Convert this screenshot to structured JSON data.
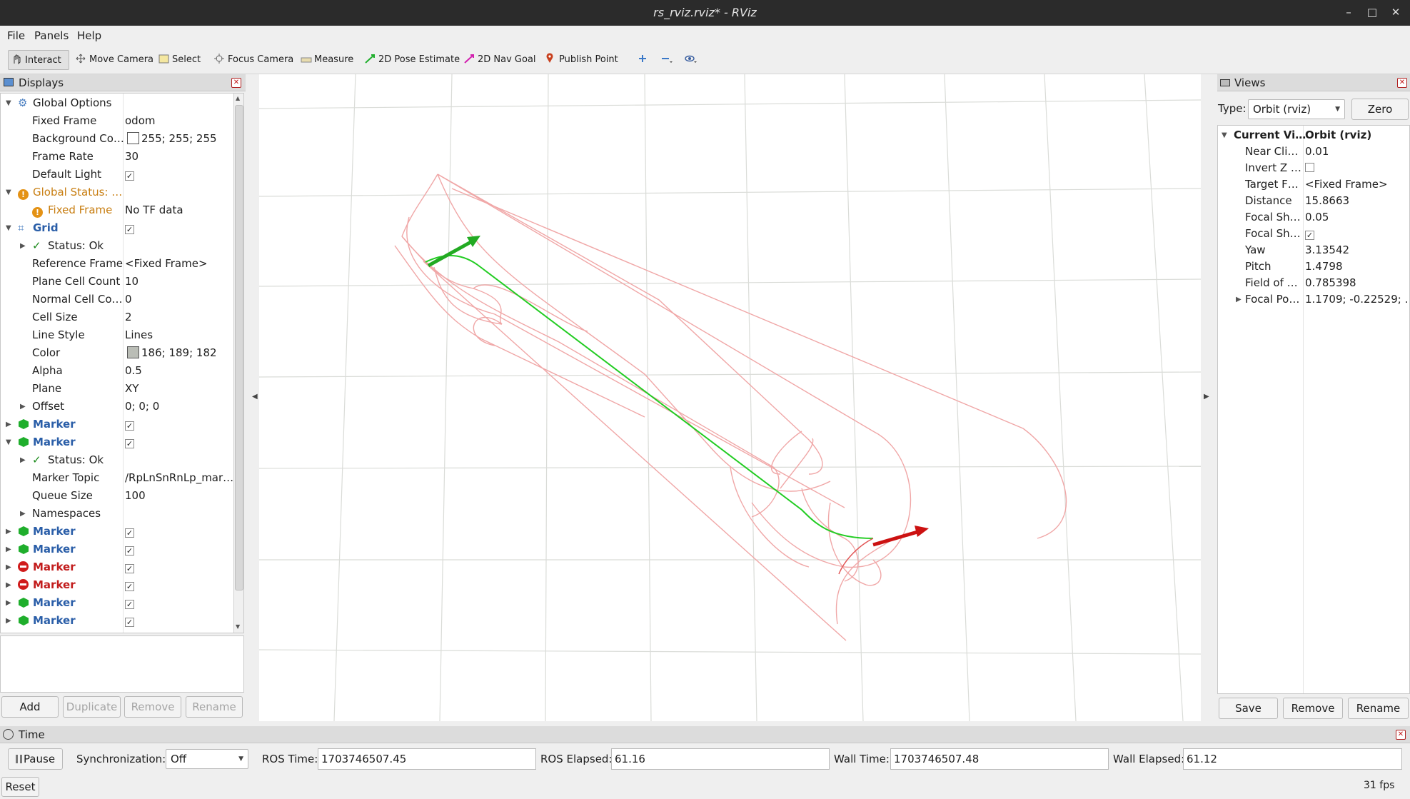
{
  "window": {
    "title": "rs_rviz.rviz* - RViz",
    "minimize": "–",
    "maximize": "□",
    "close": "✕"
  },
  "menu": [
    "File",
    "Panels",
    "Help"
  ],
  "toolbar": {
    "interact": "Interact",
    "move_camera": "Move Camera",
    "select": "Select",
    "focus_camera": "Focus Camera",
    "measure": "Measure",
    "pose_estimate": "2D Pose Estimate",
    "nav_goal": "2D Nav Goal",
    "publish_point": "Publish Point"
  },
  "displays": {
    "title": "Displays",
    "rows": [
      {
        "label": "Global Options",
        "value": ""
      },
      {
        "label": "Fixed Frame",
        "value": "odom"
      },
      {
        "label": "Background Co…",
        "value": "255; 255; 255"
      },
      {
        "label": "Frame Rate",
        "value": "30"
      },
      {
        "label": "Default Light",
        "value": ""
      },
      {
        "label": "Global Status: …",
        "value": ""
      },
      {
        "label": "Fixed Frame",
        "value": "No TF data"
      },
      {
        "label": "Grid",
        "value": ""
      },
      {
        "label": "Status: Ok",
        "value": ""
      },
      {
        "label": "Reference Frame",
        "value": "<Fixed Frame>"
      },
      {
        "label": "Plane Cell Count",
        "value": "10"
      },
      {
        "label": "Normal Cell Co…",
        "value": "0"
      },
      {
        "label": "Cell Size",
        "value": "2"
      },
      {
        "label": "Line Style",
        "value": "Lines"
      },
      {
        "label": "Color",
        "value": "186; 189; 182"
      },
      {
        "label": "Alpha",
        "value": "0.5"
      },
      {
        "label": "Plane",
        "value": "XY"
      },
      {
        "label": "Offset",
        "value": "0; 0; 0"
      },
      {
        "label": "Marker",
        "value": ""
      },
      {
        "label": "Marker",
        "value": ""
      },
      {
        "label": "Status: Ok",
        "value": ""
      },
      {
        "label": "Marker Topic",
        "value": "/RpLnSnRnLp_mar…"
      },
      {
        "label": "Queue Size",
        "value": "100"
      },
      {
        "label": "Namespaces",
        "value": ""
      },
      {
        "label": "Marker",
        "value": ""
      },
      {
        "label": "Marker",
        "value": ""
      },
      {
        "label": "Marker",
        "value": ""
      },
      {
        "label": "Marker",
        "value": ""
      },
      {
        "label": "Marker",
        "value": ""
      },
      {
        "label": "Marker",
        "value": ""
      }
    ],
    "buttons": {
      "add": "Add",
      "duplicate": "Duplicate",
      "remove": "Remove",
      "rename": "Rename"
    }
  },
  "views": {
    "title": "Views",
    "type_label": "Type:",
    "type_value": "Orbit (rviz)",
    "zero": "Zero",
    "rows": [
      {
        "label": "Current Vi…",
        "value": "Orbit (rviz)"
      },
      {
        "label": "Near Cli…",
        "value": "0.01"
      },
      {
        "label": "Invert Z …",
        "value": ""
      },
      {
        "label": "Target F…",
        "value": "<Fixed Frame>"
      },
      {
        "label": "Distance",
        "value": "15.8663"
      },
      {
        "label": "Focal Sh…",
        "value": "0.05"
      },
      {
        "label": "Focal Sh…",
        "value": ""
      },
      {
        "label": "Yaw",
        "value": "3.13542"
      },
      {
        "label": "Pitch",
        "value": "1.4798"
      },
      {
        "label": "Field of …",
        "value": "0.785398"
      },
      {
        "label": "Focal Po…",
        "value": "1.1709; -0.22529; …"
      }
    ],
    "buttons": {
      "save": "Save",
      "remove": "Remove",
      "rename": "Rename"
    }
  },
  "time": {
    "title": "Time",
    "pause": "Pause",
    "sync_label": "Synchronization:",
    "sync_value": "Off",
    "ros_time_label": "ROS Time:",
    "ros_time": "1703746507.45",
    "ros_elapsed_label": "ROS Elapsed:",
    "ros_elapsed": "61.16",
    "wall_time_label": "Wall Time:",
    "wall_time": "1703746507.48",
    "wall_elapsed_label": "Wall Elapsed:",
    "wall_elapsed": "61.12",
    "reset": "Reset",
    "fps": "31 fps"
  },
  "colors": {
    "path_green": "#22cc22",
    "candidate_red": "#f0a0a0",
    "goal_red": "#cc1111",
    "start_green": "#22aa22",
    "grid": "#d4d6d2"
  }
}
